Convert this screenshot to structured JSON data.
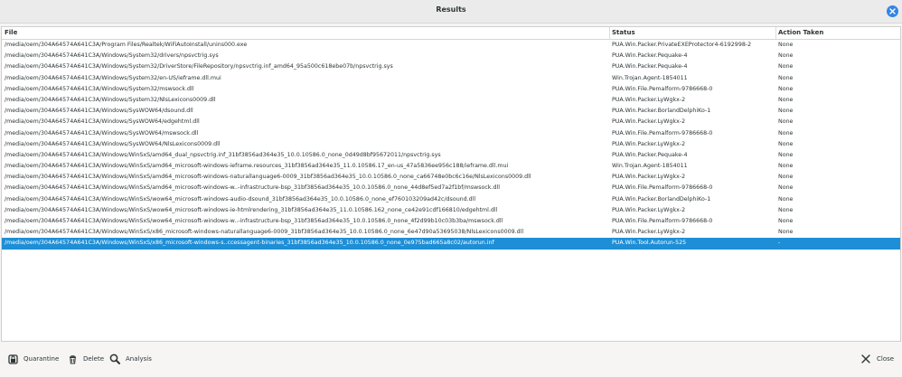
{
  "window": {
    "title": "Results"
  },
  "table": {
    "columns": {
      "file": "File",
      "status": "Status",
      "action": "Action Taken"
    },
    "rows": [
      {
        "file": "/media/oem/304A64574A641C3A/Program Files/Realtek/WiFiAutoInstall/unins000.exe",
        "status": "PUA.Win.Packer.PrivateEXEProtector4-6192998-2",
        "action": "None"
      },
      {
        "file": "/media/oem/304A64574A641C3A/Windows/System32/drivers/npsvctrig.sys",
        "status": "PUA.Win.Packer.Pequake-4",
        "action": "None"
      },
      {
        "file": "/media/oem/304A64574A641C3A/Windows/System32/DriverStore/FileRepository/npsvctrig.inf_amd64_95a500c618ebe07b/npsvctrig.sys",
        "status": "PUA.Win.Packer.Pequake-4",
        "action": "None"
      },
      {
        "file": "/media/oem/304A64574A641C3A/Windows/System32/en-US/ieframe.dll.mui",
        "status": "Win.Trojan.Agent-1854011",
        "action": "None"
      },
      {
        "file": "/media/oem/304A64574A641C3A/Windows/System32/mswsock.dll",
        "status": "PUA.Win.File.Pemalform-9786668-0",
        "action": "None"
      },
      {
        "file": "/media/oem/304A64574A641C3A/Windows/System32/NlsLexicons0009.dll",
        "status": "PUA.Win.Packer.LyWgkx-2",
        "action": "None"
      },
      {
        "file": "/media/oem/304A64574A641C3A/Windows/SysWOW64/dsound.dll",
        "status": "PUA.Win.Packer.BorlandDelphiKo-1",
        "action": "None"
      },
      {
        "file": "/media/oem/304A64574A641C3A/Windows/SysWOW64/edgehtml.dll",
        "status": "PUA.Win.Packer.LyWgkx-2",
        "action": "None"
      },
      {
        "file": "/media/oem/304A64574A641C3A/Windows/SysWOW64/mswsock.dll",
        "status": "PUA.Win.File.Pemalform-9786668-0",
        "action": "None"
      },
      {
        "file": "/media/oem/304A64574A641C3A/Windows/SysWOW64/NlsLexicons0009.dll",
        "status": "PUA.Win.Packer.LyWgkx-2",
        "action": "None"
      },
      {
        "file": "/media/oem/304A64574A641C3A/Windows/WinSxS/amd64_dual_npsvctrig.inf_31bf3856ad364e35_10.0.10586.0_none_0d49d8bf95672011/npsvctrig.sys",
        "status": "PUA.Win.Packer.Pequake-4",
        "action": "None"
      },
      {
        "file": "/media/oem/304A64574A641C3A/Windows/WinSxS/amd64_microsoft-windows-ieframe.resources_31bf3856ad364e35_11.0.10586.17_en-us_47a5836ee956c188/ieframe.dll.mui",
        "status": "Win.Trojan.Agent-1854011",
        "action": "None"
      },
      {
        "file": "/media/oem/304A64574A641C3A/Windows/WinSxS/amd64_microsoft-windows-naturallanguage6-0009_31bf3856ad364e35_10.0.10586.0_none_ca66748e0bc6c16e/NlsLexicons0009.dll",
        "status": "PUA.Win.Packer.LyWgkx-2",
        "action": "None"
      },
      {
        "file": "/media/oem/304A64574A641C3A/Windows/WinSxS/amd64_microsoft-windows-w..-infrastructure-bsp_31bf3856ad364e35_10.0.10586.0_none_44d8ef5ed7a2f1bf/mswsock.dll",
        "status": "PUA.Win.File.Pemalform-9786668-0",
        "action": "None"
      },
      {
        "file": "/media/oem/304A64574A641C3A/Windows/WinSxS/wow64_microsoft-windows-audio-dsound_31bf3856ad364e35_10.0.10586.0_none_ef760103209ad42c/dsound.dll",
        "status": "PUA.Win.Packer.BorlandDelphiKo-1",
        "action": "None"
      },
      {
        "file": "/media/oem/304A64574A641C3A/Windows/WinSxS/wow64_microsoft-windows-ie-htmlrendering_31bf3856ad364e35_11.0.10586.162_none_ce42e91cdf166810/edgehtml.dll",
        "status": "PUA.Win.Packer.LyWgkx-2",
        "action": "None"
      },
      {
        "file": "/media/oem/304A64574A641C3A/Windows/WinSxS/wow64_microsoft-windows-w..-infrastructure-bsp_31bf3856ad364e35_10.0.10586.0_none_4f2d99b10c03b3ba/mswsock.dll",
        "status": "PUA.Win.File.Pemalform-9786668-0",
        "action": "None"
      },
      {
        "file": "/media/oem/304A64574A641C3A/Windows/WinSxS/x86_microsoft-windows-naturallanguage6-0009_31bf3856ad364e35_10.0.10586.0_none_6e47d90a53695038/NlsLexicons0009.dll",
        "status": "PUA.Win.Packer.LyWgkx-2",
        "action": "None"
      },
      {
        "file": "/media/oem/304A64574A641C3A/Windows/WinSxS/x86_microsoft-windows-s..ccessagent-binaries_31bf3856ad364e35_10.0.10586.0_none_0e975bad665a8c02/autorun.inf",
        "status": "PUA.Win.Tool.Autorun-525",
        "action": "-",
        "selected": true
      }
    ]
  },
  "footer": {
    "quarantine_label": "Quarantine",
    "delete_label": "Delete",
    "analysis_label": "Analysis",
    "close_label": "Close"
  },
  "icons": {
    "window_close": "close-icon",
    "quarantine": "lock-icon",
    "delete": "trash-icon",
    "analysis": "magnifier-icon",
    "close": "x-icon"
  },
  "colors": {
    "selection": "#1e8fd6",
    "close_badge": "#3584e4"
  }
}
